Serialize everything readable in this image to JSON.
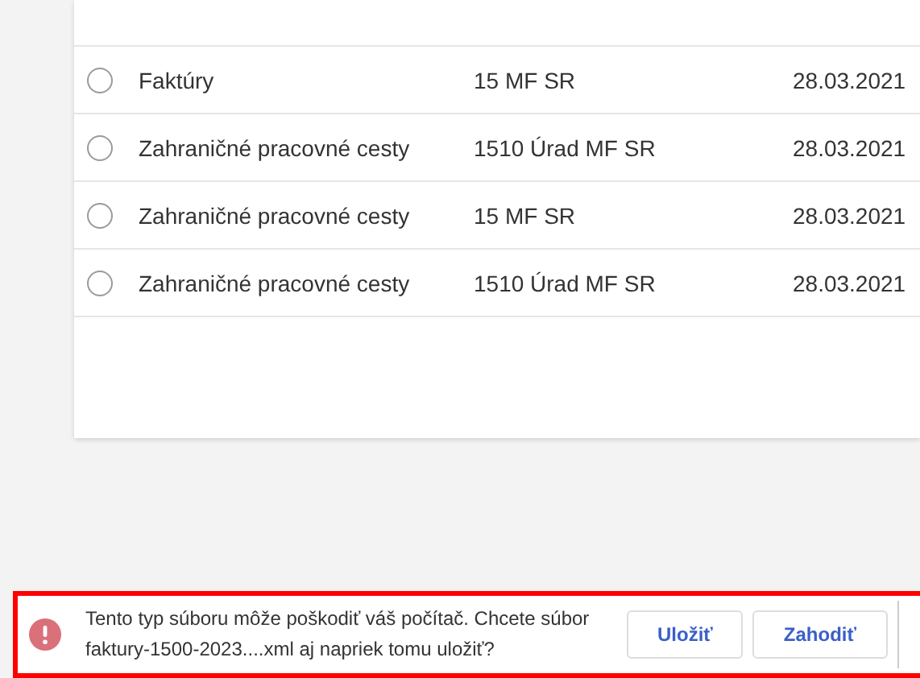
{
  "table": {
    "rows": [
      {
        "selected": false,
        "name": "Faktúry",
        "organization": "15 MF SR",
        "date": "28.03.2021"
      },
      {
        "selected": false,
        "name": "Zahraničné pracovné cesty",
        "organization": "1510 Úrad MF SR",
        "date": "28.03.2021"
      },
      {
        "selected": false,
        "name": "Zahraničné pracovné cesty",
        "organization": "15 MF SR",
        "date": "28.03.2021"
      },
      {
        "selected": false,
        "name": "Zahraničné pracovné cesty",
        "organization": "1510 Úrad MF SR",
        "date": "28.03.2021"
      }
    ]
  },
  "download_bar": {
    "message": "Tento typ súboru môže poškodiť váš počítač. Chcete súbor faktury-1500-2023....xml aj napriek tomu uložiť?",
    "buttons": [
      "Uložiť",
      "Zahodiť"
    ]
  }
}
